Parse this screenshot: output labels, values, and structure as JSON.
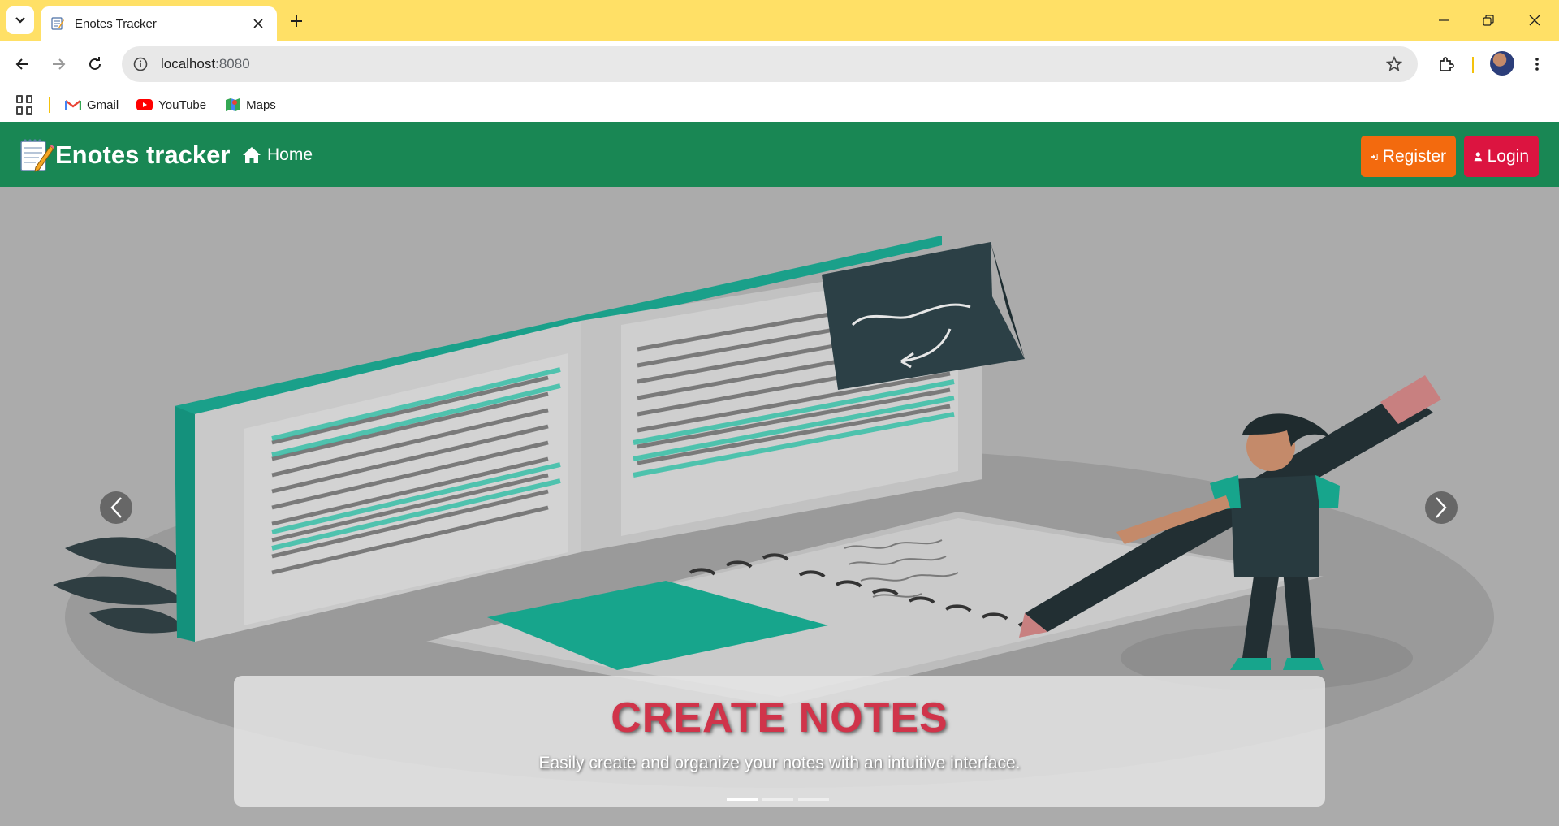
{
  "browser": {
    "tab_title": "Enotes Tracker",
    "url_host": "localhost",
    "url_port": ":8080",
    "bookmarks": [
      {
        "label": "Gmail",
        "icon": "gmail-icon"
      },
      {
        "label": "YouTube",
        "icon": "youtube-icon"
      },
      {
        "label": "Maps",
        "icon": "maps-icon"
      }
    ]
  },
  "navbar": {
    "brand": "Enotes tracker",
    "brand_icon": "notepad-pencil-icon",
    "home_label": "Home",
    "register_label": "Register",
    "login_label": "Login",
    "colors": {
      "bg": "#198754",
      "register": "#f36a0e",
      "login": "#dc1440"
    }
  },
  "carousel": {
    "caption_title": "CREATE NOTES",
    "caption_text": "Easily create and organize your notes with an intuitive interface.",
    "slide_count": 3,
    "active_slide": 1
  }
}
